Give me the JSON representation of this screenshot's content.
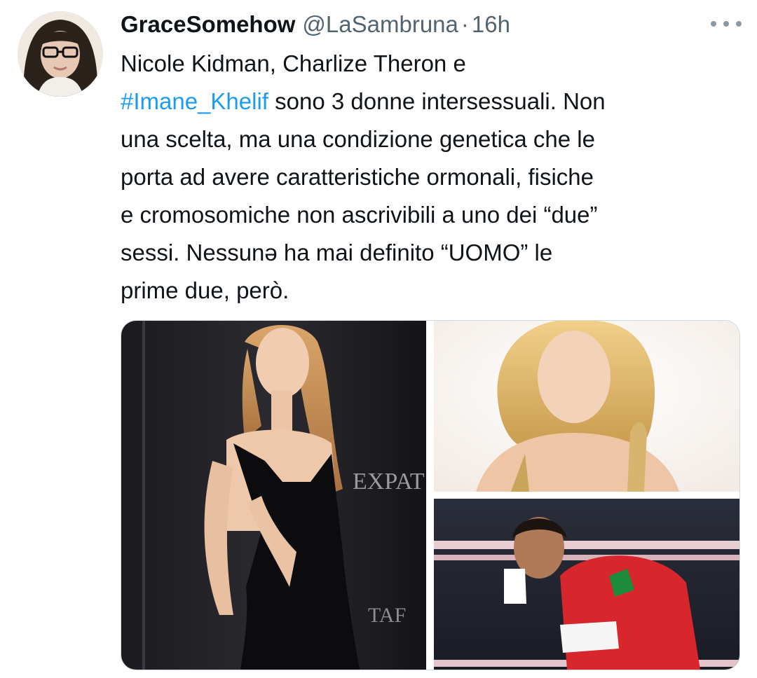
{
  "tweet": {
    "display_name": "GraceSomehow",
    "handle": "@LaSambruna",
    "separator": "·",
    "time": "16h",
    "text_lines": [
      {
        "segments": [
          {
            "text": "Nicole Kidman, Charlize Theron e",
            "type": "text"
          }
        ]
      },
      {
        "segments": [
          {
            "text": "#Imane_Khelif",
            "type": "hashtag"
          },
          {
            "text": " sono 3 donne intersessuali. Non",
            "type": "text"
          }
        ]
      },
      {
        "segments": [
          {
            "text": "una scelta, ma una condizione genetica che le",
            "type": "text"
          }
        ]
      },
      {
        "segments": [
          {
            "text": "porta ad avere caratteristiche ormonali, fisiche",
            "type": "text"
          }
        ]
      },
      {
        "segments": [
          {
            "text": "e cromosomiche non ascrivibili a uno dei “due”",
            "type": "text"
          }
        ]
      },
      {
        "segments": [
          {
            "text": "sessi. Nessunə ha mai definito “UOMO” le",
            "type": "text"
          }
        ]
      },
      {
        "segments": [
          {
            "text": "prime due, però.",
            "type": "text"
          }
        ]
      }
    ],
    "more_icon": "more-horizontal-icon",
    "photo_text": {
      "backdrop_1": "EXPAT",
      "backdrop_2": "TAF"
    }
  },
  "colors": {
    "text": "#0f1419",
    "secondary": "#536471",
    "link": "#1d9bf0",
    "border": "#cfd9de"
  }
}
